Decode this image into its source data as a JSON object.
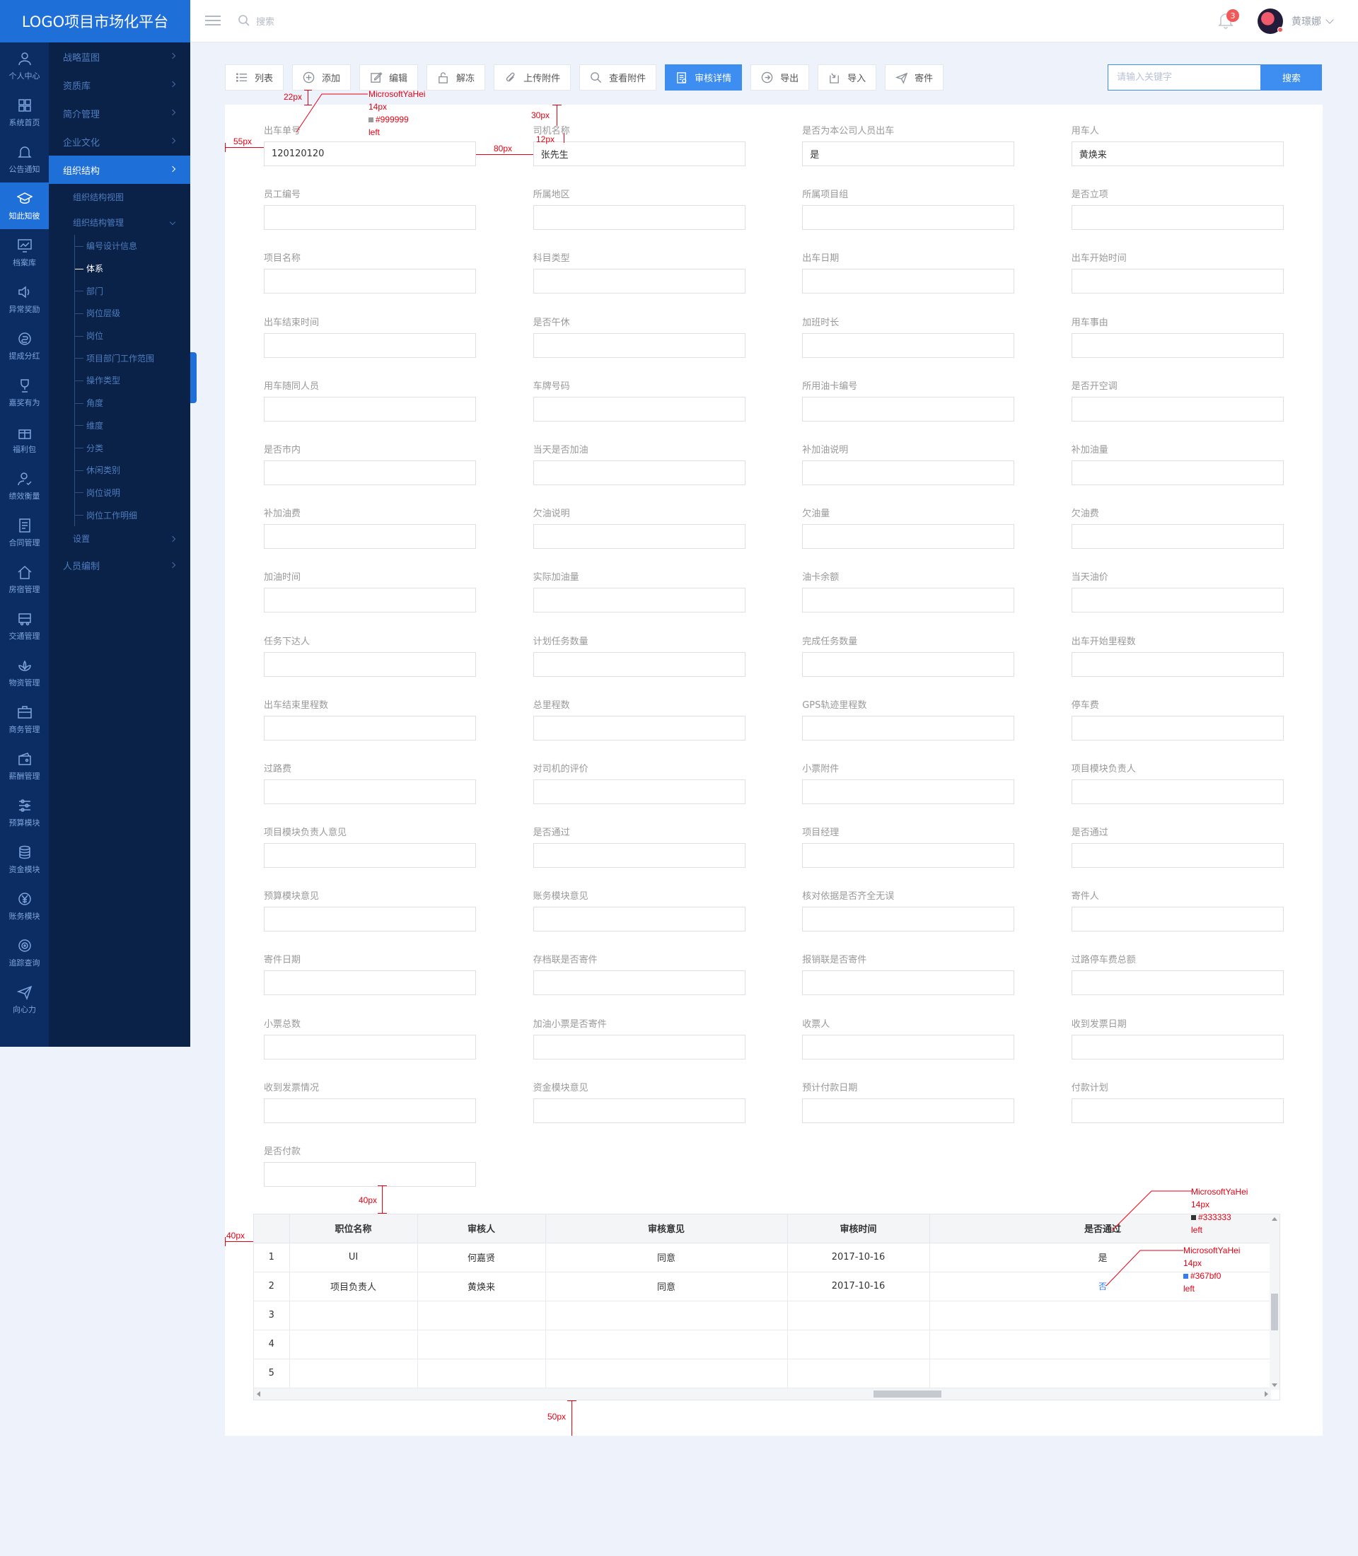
{
  "app": {
    "logo_title": "LOGO项目市场化平台"
  },
  "topbar": {
    "search_placeholder": "搜索",
    "notification_count": "3",
    "user_name": "黄璟娜"
  },
  "rail": [
    {
      "label": "个人中心",
      "icon": "user-icon"
    },
    {
      "label": "系统首页",
      "icon": "grid-icon"
    },
    {
      "label": "公告通知",
      "icon": "bell-icon"
    },
    {
      "label": "知此知彼",
      "icon": "graduation-cap-icon",
      "active": true
    },
    {
      "label": "档案库",
      "icon": "chart-screen-icon"
    },
    {
      "label": "异常奖励",
      "icon": "speaker-icon"
    },
    {
      "label": "提成分红",
      "icon": "coin-icon"
    },
    {
      "label": "嘉奖有为",
      "icon": "trophy-icon"
    },
    {
      "label": "福利包",
      "icon": "gift-icon"
    },
    {
      "label": "绩效衡量",
      "icon": "person-check-icon"
    },
    {
      "label": "合同管理",
      "icon": "document-icon"
    },
    {
      "label": "房宿管理",
      "icon": "house-icon"
    },
    {
      "label": "交通管理",
      "icon": "bus-icon"
    },
    {
      "label": "物资管理",
      "icon": "lotus-icon"
    },
    {
      "label": "商务管理",
      "icon": "briefcase-icon"
    },
    {
      "label": "薪酬管理",
      "icon": "wallet-icon"
    },
    {
      "label": "预算模块",
      "icon": "sliders-icon"
    },
    {
      "label": "资金模块",
      "icon": "coins-stack-icon"
    },
    {
      "label": "账务模块",
      "icon": "yen-icon"
    },
    {
      "label": "追踪查询",
      "icon": "target-icon"
    },
    {
      "label": "向心力",
      "icon": "send-icon"
    }
  ],
  "submenu": {
    "top": [
      "战略蓝图",
      "资质库",
      "简介管理",
      "企业文化"
    ],
    "active": "组织结构",
    "children": [
      {
        "label": "组织结构视图"
      },
      {
        "label": "组织结构管理",
        "tree": [
          "编号设计信息",
          "体系",
          "部门",
          "岗位层级",
          "岗位",
          "项目部门工作范围",
          "操作类型",
          "角度",
          "维度",
          "分类",
          "休闲类别",
          "岗位说明",
          "岗位工作明细"
        ],
        "current": "体系"
      },
      {
        "label": "设置"
      }
    ],
    "bottom": [
      "人员编制"
    ]
  },
  "toolbar": [
    {
      "label": "列表",
      "icon": "list-icon"
    },
    {
      "label": "添加",
      "icon": "plus-circle-icon"
    },
    {
      "label": "编辑",
      "icon": "edit-icon"
    },
    {
      "label": "解冻",
      "icon": "unlock-icon"
    },
    {
      "label": "上传附件",
      "icon": "paperclip-icon"
    },
    {
      "label": "查看附件",
      "icon": "search-icon"
    },
    {
      "label": "审核详情",
      "icon": "audit-doc-icon",
      "primary": true
    },
    {
      "label": "导出",
      "icon": "export-icon"
    },
    {
      "label": "导入",
      "icon": "import-icon"
    },
    {
      "label": "寄件",
      "icon": "send-icon"
    }
  ],
  "search": {
    "placeholder": "请输入关键字",
    "button": "搜索"
  },
  "form_fields": [
    {
      "label": "出车单号",
      "value": "120120120"
    },
    {
      "label": "司机名称",
      "value": "张先生"
    },
    {
      "label": "是否为本公司人员出车",
      "value": "是"
    },
    {
      "label": "用车人",
      "value": "黄焕来"
    },
    {
      "label": "员工编号",
      "value": ""
    },
    {
      "label": "所属地区",
      "value": ""
    },
    {
      "label": "所属项目组",
      "value": ""
    },
    {
      "label": "是否立项",
      "value": ""
    },
    {
      "label": "项目名称",
      "value": ""
    },
    {
      "label": "科目类型",
      "value": ""
    },
    {
      "label": "出车日期",
      "value": ""
    },
    {
      "label": "出车开始时间",
      "value": ""
    },
    {
      "label": "出车结束时间",
      "value": ""
    },
    {
      "label": "是否午休",
      "value": ""
    },
    {
      "label": "加班时长",
      "value": ""
    },
    {
      "label": "用车事由",
      "value": ""
    },
    {
      "label": "用车随同人员",
      "value": ""
    },
    {
      "label": "车牌号码",
      "value": ""
    },
    {
      "label": "所用油卡编号",
      "value": ""
    },
    {
      "label": "是否开空调",
      "value": ""
    },
    {
      "label": "是否市内",
      "value": ""
    },
    {
      "label": "当天是否加油",
      "value": ""
    },
    {
      "label": "补加油说明",
      "value": ""
    },
    {
      "label": "补加油量",
      "value": ""
    },
    {
      "label": "补加油费",
      "value": ""
    },
    {
      "label": "欠油说明",
      "value": ""
    },
    {
      "label": "欠油量",
      "value": ""
    },
    {
      "label": "欠油费",
      "value": ""
    },
    {
      "label": "加油时间",
      "value": ""
    },
    {
      "label": "实际加油量",
      "value": ""
    },
    {
      "label": "油卡余额",
      "value": ""
    },
    {
      "label": "当天油价",
      "value": ""
    },
    {
      "label": "任务下达人",
      "value": ""
    },
    {
      "label": "计划任务数量",
      "value": ""
    },
    {
      "label": "完成任务数量",
      "value": ""
    },
    {
      "label": "出车开始里程数",
      "value": ""
    },
    {
      "label": "出车结束里程数",
      "value": ""
    },
    {
      "label": "总里程数",
      "value": ""
    },
    {
      "label": "GPS轨迹里程数",
      "value": ""
    },
    {
      "label": "停车费",
      "value": ""
    },
    {
      "label": "过路费",
      "value": ""
    },
    {
      "label": "对司机的评价",
      "value": ""
    },
    {
      "label": "小票附件",
      "value": ""
    },
    {
      "label": "项目模块负责人",
      "value": ""
    },
    {
      "label": "项目模块负责人意见",
      "value": ""
    },
    {
      "label": "是否通过",
      "value": ""
    },
    {
      "label": "项目经理",
      "value": ""
    },
    {
      "label": "是否通过",
      "value": ""
    },
    {
      "label": "预算模块意见",
      "value": ""
    },
    {
      "label": "账务模块意见",
      "value": ""
    },
    {
      "label": "核对依据是否齐全无误",
      "value": ""
    },
    {
      "label": "寄件人",
      "value": ""
    },
    {
      "label": "寄件日期",
      "value": ""
    },
    {
      "label": "存档联是否寄件",
      "value": ""
    },
    {
      "label": "报销联是否寄件",
      "value": ""
    },
    {
      "label": "过路停车费总额",
      "value": ""
    },
    {
      "label": "小票总数",
      "value": ""
    },
    {
      "label": "加油小票是否寄件",
      "value": ""
    },
    {
      "label": "收票人",
      "value": ""
    },
    {
      "label": "收到发票日期",
      "value": ""
    },
    {
      "label": "收到发票情况",
      "value": ""
    },
    {
      "label": "资金模块意见",
      "value": ""
    },
    {
      "label": "预计付款日期",
      "value": ""
    },
    {
      "label": "付款计划",
      "value": ""
    },
    {
      "label": "是否付款",
      "value": ""
    }
  ],
  "review_table": {
    "headers": [
      "",
      "职位名称",
      "审核人",
      "审核意见",
      "审核时间",
      "是否通过"
    ],
    "rows": [
      [
        "1",
        "UI",
        "何嘉贤",
        "同意",
        "2017-10-16",
        "是"
      ],
      [
        "2",
        "项目负责人",
        "黄焕来",
        "同意",
        "2017-10-16",
        "否"
      ],
      [
        "3",
        "",
        "",
        "",
        "",
        ""
      ],
      [
        "4",
        "",
        "",
        "",
        "",
        ""
      ],
      [
        "5",
        "",
        "",
        "",
        "",
        ""
      ]
    ]
  },
  "annotations": {
    "label_spec": [
      "MicrosoftYaHei",
      "14px",
      "#999999",
      "left"
    ],
    "header_spec": [
      "MicrosoftYaHei",
      "14px",
      "#333333",
      "left"
    ],
    "link_spec": [
      "MicrosoftYaHei",
      "14px",
      "#367bf0",
      "left"
    ],
    "d22": "22px",
    "d30": "30px",
    "d12": "12px",
    "d55": "55px",
    "d80": "80px",
    "d40a": "40px",
    "d40b": "40px",
    "d50": "50px",
    "swatches": {
      "label": "#999999",
      "header": "#333333",
      "link": "#367bf0"
    }
  },
  "colors": {
    "brand": "#1f6fd8",
    "rail_bg": "#0b2d63",
    "submenu_bg": "#0a2148",
    "primary_button": "#3d8ef0",
    "annotation": "#e60012"
  }
}
